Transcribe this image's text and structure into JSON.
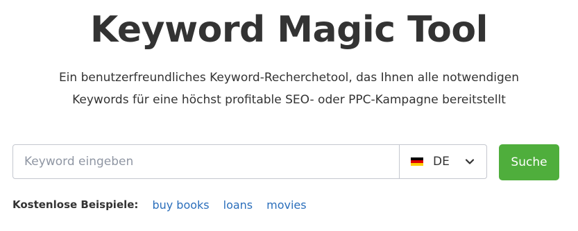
{
  "page": {
    "title": "Keyword Magic Tool",
    "subtitle_line1": "Ein benutzerfreundliches Keyword-Recherchetool, das Ihnen alle notwendigen",
    "subtitle_line2": "Keywords für eine höchst profitable SEO- oder PPC-Kampagne bereitstellt"
  },
  "search": {
    "placeholder": "Keyword eingeben",
    "value": "",
    "country": {
      "code": "DE",
      "flag_icon": "germany-flag-icon",
      "dropdown_icon": "chevron-down-icon"
    },
    "button_label": "Suche"
  },
  "examples": {
    "label": "Kostenlose Beispiele:",
    "links": [
      "buy books",
      "loans",
      "movies"
    ]
  },
  "colors": {
    "button_bg": "#4fae3c",
    "link": "#2a6ebb",
    "text": "#333333",
    "border": "#c4c7cf",
    "flag_black": "#000000",
    "flag_red": "#dd0000",
    "flag_gold": "#ffce00"
  }
}
